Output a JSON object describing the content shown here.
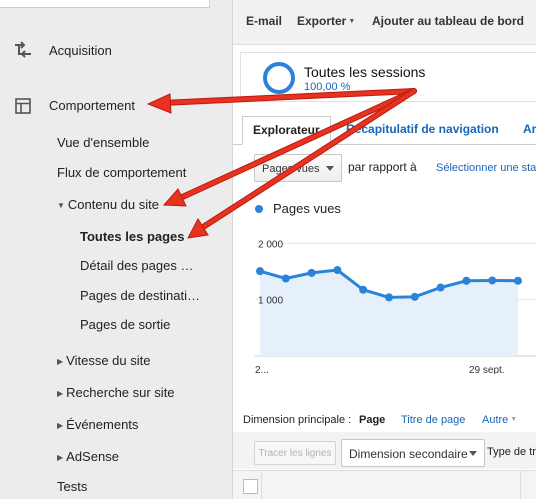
{
  "sidebar": {
    "acquisition": "Acquisition",
    "behavior": "Comportement",
    "overview": "Vue d'ensemble",
    "behavior_flow": "Flux de comportement",
    "site_content": "Contenu du site",
    "all_pages": "Toutes les pages",
    "content_drilldown": "Détail des pages …",
    "landing_pages": "Pages de destinati…",
    "exit_pages": "Pages de sortie",
    "site_speed": "Vitesse du site",
    "site_search": "Recherche sur site",
    "events": "Événements",
    "adsense": "AdSense",
    "tests": "Tests"
  },
  "toolbar": {
    "email": "E-mail",
    "export": "Exporter",
    "add_dashboard": "Ajouter au tableau de bord"
  },
  "segment": {
    "title": "Toutes les sessions",
    "percent": "100,00 %"
  },
  "tabs": {
    "explorer": "Explorateur",
    "nav_summary": "Récapitulatif de navigation",
    "more": "Ar"
  },
  "controls": {
    "metric_select": "Pages vues",
    "vs_label": "par rapport à",
    "select_metric_link": "Sélectionner une stat"
  },
  "legend": {
    "label": "Pages vues"
  },
  "primary_dimension": {
    "label": "Dimension principale :",
    "page": "Page",
    "page_title": "Titre de page",
    "other": "Autre"
  },
  "secondary": {
    "plot_rows": "Tracer les lignes",
    "secondary_dimension": "Dimension secondaire",
    "sort_type": "Type de tr"
  },
  "colors": {
    "accent": "#2a82da",
    "link": "#1a66b8",
    "annotation_arrow": "#e8321f"
  },
  "chart_data": {
    "type": "area",
    "series": [
      {
        "name": "Pages vues",
        "values": [
          1505,
          1375,
          1475,
          1525,
          1175,
          1040,
          1050,
          1215,
          1335,
          1340,
          1335
        ]
      }
    ],
    "y_tick_labels": [
      "2 000",
      "1 000"
    ],
    "x_tick_labels": [
      "2...",
      "29 sept."
    ],
    "ylim": [
      0,
      2200
    ]
  }
}
